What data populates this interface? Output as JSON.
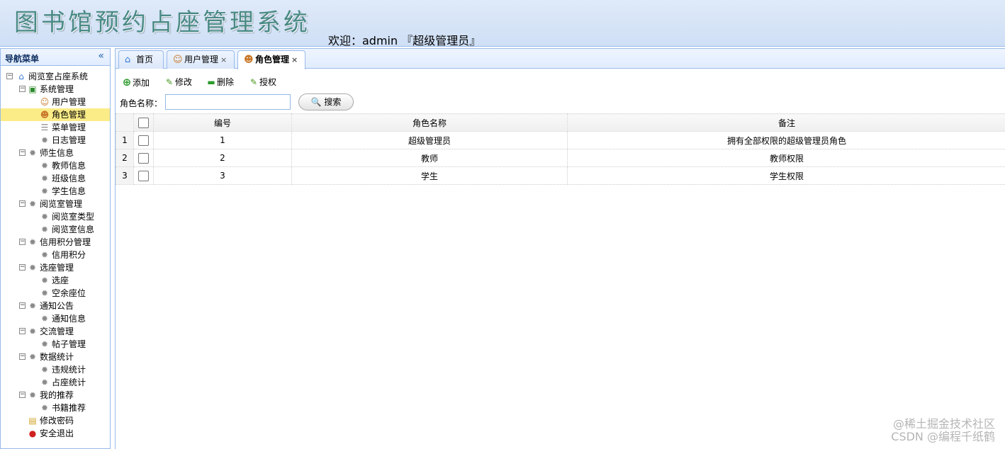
{
  "header": {
    "app_title": "图书馆预约占座管理系统",
    "welcome": "欢迎：admin 『超级管理员』"
  },
  "sidebar": {
    "title": "导航菜单",
    "tree": [
      {
        "label": "阅览室占座系统",
        "level": 0,
        "toggle": "⊟",
        "icon": "home-icon"
      },
      {
        "label": "系统管理",
        "level": 1,
        "toggle": "⊟",
        "icon": "system-icon"
      },
      {
        "label": "用户管理",
        "level": 2,
        "icon": "user-icon"
      },
      {
        "label": "角色管理",
        "level": 2,
        "icon": "role-icon",
        "selected": true
      },
      {
        "label": "菜单管理",
        "level": 2,
        "icon": "menu-icon"
      },
      {
        "label": "日志管理",
        "level": 2,
        "icon": "gear-icon"
      },
      {
        "label": "师生信息",
        "level": 1,
        "toggle": "⊟",
        "icon": "gear-icon"
      },
      {
        "label": "教师信息",
        "level": 2,
        "icon": "gear-icon"
      },
      {
        "label": "班级信息",
        "level": 2,
        "icon": "gear-icon"
      },
      {
        "label": "学生信息",
        "level": 2,
        "icon": "gear-icon"
      },
      {
        "label": "阅览室管理",
        "level": 1,
        "toggle": "⊟",
        "icon": "gear-icon"
      },
      {
        "label": "阅览室类型",
        "level": 2,
        "icon": "gear-icon"
      },
      {
        "label": "阅览室信息",
        "level": 2,
        "icon": "gear-icon"
      },
      {
        "label": "信用积分管理",
        "level": 1,
        "toggle": "⊟",
        "icon": "gear-icon"
      },
      {
        "label": "信用积分",
        "level": 2,
        "icon": "gear-icon"
      },
      {
        "label": "选座管理",
        "level": 1,
        "toggle": "⊟",
        "icon": "gear-icon"
      },
      {
        "label": "选座",
        "level": 2,
        "icon": "gear-icon"
      },
      {
        "label": "空余座位",
        "level": 2,
        "icon": "gear-icon"
      },
      {
        "label": "通知公告",
        "level": 1,
        "toggle": "⊟",
        "icon": "gear-icon"
      },
      {
        "label": "通知信息",
        "level": 2,
        "icon": "gear-icon"
      },
      {
        "label": "交流管理",
        "level": 1,
        "toggle": "⊟",
        "icon": "gear-icon"
      },
      {
        "label": "帖子管理",
        "level": 2,
        "icon": "gear-icon"
      },
      {
        "label": "数据统计",
        "level": 1,
        "toggle": "⊟",
        "icon": "gear-icon"
      },
      {
        "label": "违规统计",
        "level": 2,
        "icon": "gear-icon"
      },
      {
        "label": "占座统计",
        "level": 2,
        "icon": "gear-icon"
      },
      {
        "label": "我的推荐",
        "level": 1,
        "toggle": "⊟",
        "icon": "gear-icon"
      },
      {
        "label": "书籍推荐",
        "level": 2,
        "icon": "gear-icon"
      },
      {
        "label": "修改密码",
        "level": 1,
        "icon": "password-icon"
      },
      {
        "label": "安全退出",
        "level": 1,
        "icon": "logout-icon"
      }
    ]
  },
  "tabs": [
    {
      "label": "首页",
      "icon": "home-icon",
      "closable": false
    },
    {
      "label": "用户管理",
      "icon": "user-icon",
      "closable": true
    },
    {
      "label": "角色管理",
      "icon": "role-icon",
      "closable": true,
      "active": true
    }
  ],
  "toolbar": {
    "add_label": "添加",
    "edit_label": "修改",
    "delete_label": "删除",
    "authorize_label": "授权"
  },
  "search": {
    "label": "角色名称：",
    "value": "",
    "button_label": "搜索"
  },
  "table": {
    "columns": [
      "编号",
      "角色名称",
      "备注"
    ],
    "rows": [
      {
        "rownum": "1",
        "id": "1",
        "name": "超级管理员",
        "remark": "拥有全部权限的超级管理员角色"
      },
      {
        "rownum": "2",
        "id": "2",
        "name": "教师",
        "remark": "教师权限"
      },
      {
        "rownum": "3",
        "id": "3",
        "name": "学生",
        "remark": "学生权限"
      }
    ]
  },
  "watermark": {
    "line1": "@稀土掘金技术社区",
    "line2": "CSDN @编程千纸鹤"
  },
  "colors": {
    "border": "#99bbe8",
    "selected": "#fbec88",
    "title": "#4a8a86"
  }
}
